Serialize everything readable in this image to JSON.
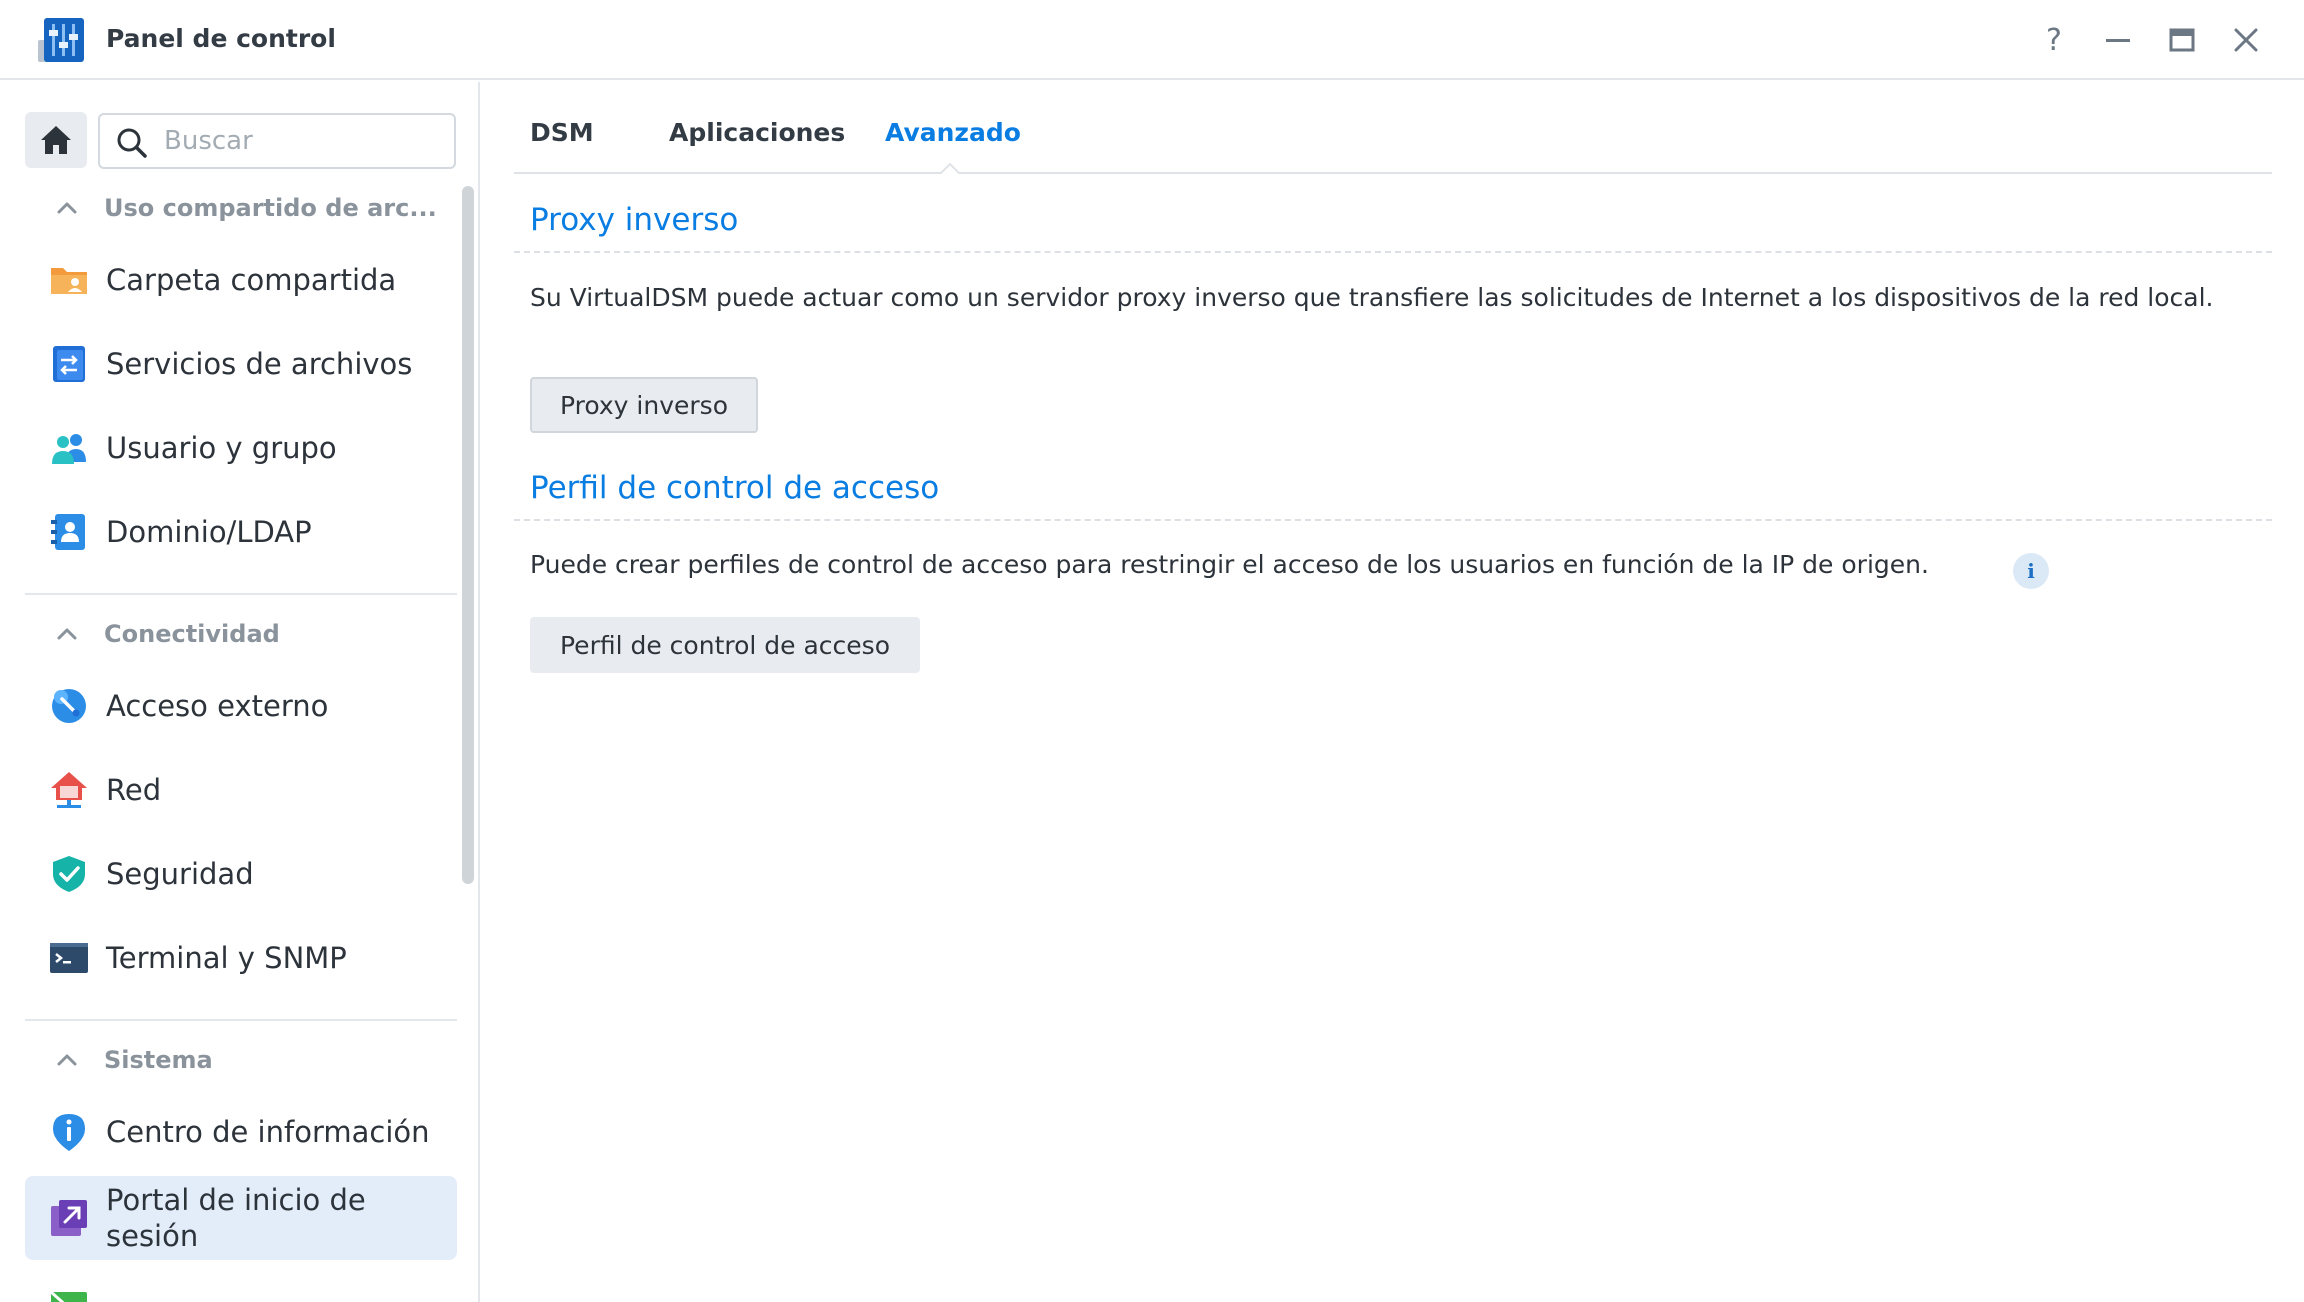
{
  "window": {
    "title": "Panel de control",
    "help_label": "?",
    "icons": [
      "control-panel-icon",
      "help-icon",
      "minimize-icon",
      "maximize-icon",
      "close-icon"
    ]
  },
  "sidebar": {
    "search_placeholder": "Buscar",
    "sections": [
      {
        "title": "Uso compartido de arc...",
        "items": [
          {
            "label": "Carpeta compartida",
            "icon": "shared-folder-icon"
          },
          {
            "label": "Servicios de archivos",
            "icon": "file-services-icon"
          },
          {
            "label": "Usuario y grupo",
            "icon": "user-group-icon"
          },
          {
            "label": "Dominio/LDAP",
            "icon": "domain-ldap-icon"
          }
        ]
      },
      {
        "title": "Conectividad",
        "items": [
          {
            "label": "Acceso externo",
            "icon": "external-access-icon"
          },
          {
            "label": "Red",
            "icon": "network-icon"
          },
          {
            "label": "Seguridad",
            "icon": "security-shield-icon"
          },
          {
            "label": "Terminal y SNMP",
            "icon": "terminal-icon"
          }
        ]
      },
      {
        "title": "Sistema",
        "items": [
          {
            "label": "Centro de información",
            "icon": "info-center-icon"
          },
          {
            "label": "Portal de inicio de sesión",
            "icon": "login-portal-icon",
            "active": true
          }
        ]
      }
    ]
  },
  "tabs": [
    {
      "label": "DSM"
    },
    {
      "label": "Aplicaciones"
    },
    {
      "label": "Avanzado",
      "active": true
    }
  ],
  "content": {
    "proxy": {
      "title": "Proxy inverso",
      "description": "Su VirtualDSM puede actuar como un servidor proxy inverso que transfiere las solicitudes de Internet a los dispositivos de la red local.",
      "button": "Proxy inverso"
    },
    "acl": {
      "title": "Perfil de control de acceso",
      "description": "Puede crear perfiles de control de acceso para restringir el acceso de los usuarios en función de la IP de origen.",
      "button": "Perfil de control de acceso",
      "info_label": "i"
    }
  },
  "colors": {
    "accent": "#0a7de2",
    "active_nav_bg": "#e3edf9",
    "button_bg": "#e8ecf0"
  }
}
